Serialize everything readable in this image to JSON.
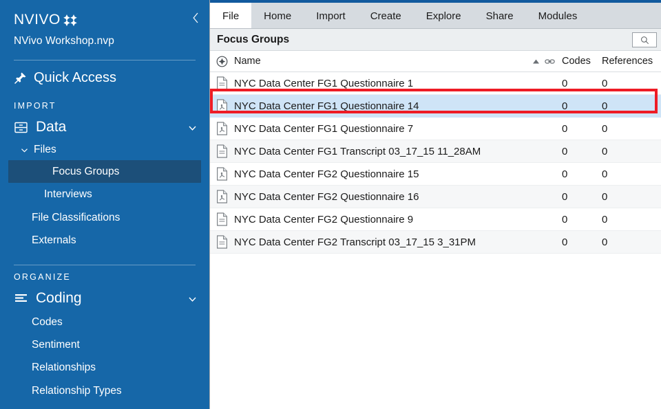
{
  "sidebar": {
    "logo_text": "NVIVO",
    "logo_icon": "nvivo-diamond-cluster-icon",
    "collapse_icon": "chevron-left-icon",
    "project_name": "NVivo Workshop.nvp",
    "quick_access": {
      "label": "Quick Access",
      "icon": "pin-icon"
    },
    "sections": [
      {
        "label": "IMPORT",
        "group": {
          "label": "Data",
          "icon": "database-icon",
          "chevron": "chevron-down-icon"
        },
        "sub": {
          "label": "Files",
          "chevron": "chevron-down-icon"
        },
        "items": [
          {
            "label": "Focus Groups",
            "selected": true
          },
          {
            "label": "Interviews",
            "selected": false
          },
          {
            "label": "File Classifications",
            "selected": false
          },
          {
            "label": "Externals",
            "selected": false
          }
        ]
      },
      {
        "label": "ORGANIZE",
        "group": {
          "label": "Coding",
          "icon": "list-lines-icon",
          "chevron": "chevron-down-icon"
        },
        "items": [
          {
            "label": "Codes",
            "selected": false
          },
          {
            "label": "Sentiment",
            "selected": false
          },
          {
            "label": "Relationships",
            "selected": false
          },
          {
            "label": "Relationship Types",
            "selected": false
          }
        ]
      }
    ]
  },
  "ribbon": {
    "tabs": [
      {
        "label": "File",
        "active": true
      },
      {
        "label": "Home",
        "active": false
      },
      {
        "label": "Import",
        "active": false
      },
      {
        "label": "Create",
        "active": false
      },
      {
        "label": "Explore",
        "active": false
      },
      {
        "label": "Share",
        "active": false
      },
      {
        "label": "Modules",
        "active": false
      }
    ]
  },
  "titlebar": {
    "title": "Focus Groups",
    "search": {
      "icon": "search-icon",
      "value": "",
      "placeholder": ""
    }
  },
  "list": {
    "header": {
      "select_icon": "circle-diamond-icon",
      "name": "Name",
      "sort_icon": "sort-ascending-icon",
      "link_icon": "link-chain-icon",
      "codes": "Codes",
      "references": "References"
    },
    "rows": [
      {
        "icon": "document-icon",
        "name": "NYC Data Center FG1 Questionnaire 1",
        "codes": "0",
        "references": "0",
        "selected": false
      },
      {
        "icon": "pdf-document-icon",
        "name": "NYC Data Center FG1 Questionnaire 14",
        "codes": "0",
        "references": "0",
        "selected": true
      },
      {
        "icon": "pdf-document-icon",
        "name": "NYC Data Center FG1 Questionnaire 7",
        "codes": "0",
        "references": "0",
        "selected": false
      },
      {
        "icon": "document-icon",
        "name": "NYC Data Center FG1 Transcript 03_17_15 11_28AM",
        "codes": "0",
        "references": "0",
        "selected": false
      },
      {
        "icon": "pdf-document-icon",
        "name": "NYC Data Center FG2 Questionnaire 15",
        "codes": "0",
        "references": "0",
        "selected": false
      },
      {
        "icon": "pdf-document-icon",
        "name": "NYC Data Center FG2 Questionnaire 16",
        "codes": "0",
        "references": "0",
        "selected": false
      },
      {
        "icon": "document-icon",
        "name": "NYC Data Center FG2 Questionnaire 9",
        "codes": "0",
        "references": "0",
        "selected": false
      },
      {
        "icon": "document-icon",
        "name": "NYC Data Center FG2 Transcript 03_17_15 3_31PM",
        "codes": "0",
        "references": "0",
        "selected": false
      }
    ]
  },
  "annotation": {
    "type": "red-rectangle-highlight",
    "target_row": "NYC Data Center FG1 Questionnaire 14",
    "color": "#ee1c25"
  },
  "colors": {
    "sidebar_bg": "#1667a8",
    "sidebar_selected": "#1c4f79",
    "ribbon_bg": "#d6dbe0",
    "titlebar_bg": "#eceff1",
    "row_selected": "#cfe4f7",
    "row_alt": "#f6f7f8",
    "accent_line": "#125a9e",
    "annotation": "#ee1c25"
  }
}
